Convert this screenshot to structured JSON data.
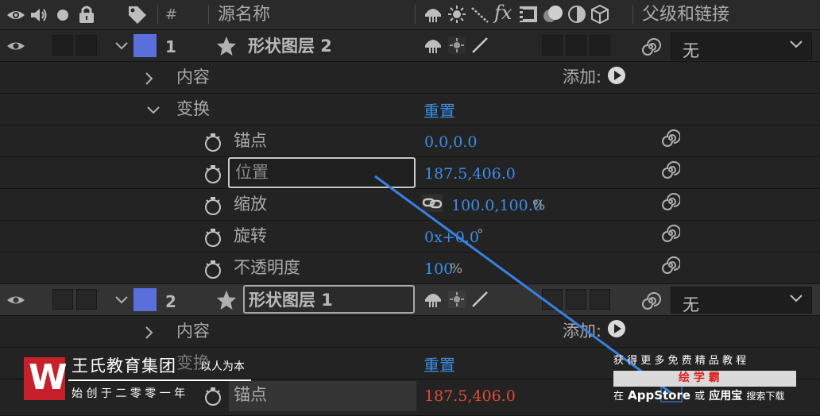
{
  "header": {
    "col_hash": "#",
    "col_source_name": "源名称",
    "col_parent": "父级和链接"
  },
  "layers": [
    {
      "number": "1",
      "name": "形状图层 2",
      "parent_value": "无",
      "color": "#5a6fdc"
    },
    {
      "number": "2",
      "name": "形状图层 1",
      "parent_value": "无",
      "color": "#5a6fdc"
    }
  ],
  "groups": {
    "contents": "内容",
    "add_label": "添加:",
    "transform": "变换",
    "reset": "重置"
  },
  "properties": {
    "anchor": {
      "label": "锚点",
      "value": "0.0,0.0"
    },
    "position": {
      "label": "位置",
      "value": "187.5,406.0"
    },
    "scale": {
      "label": "缩放",
      "value": "100.0,100.0",
      "unit": "%"
    },
    "rotation": {
      "label": "旋转",
      "value": "0x+0.0",
      "unit": "°"
    },
    "opacity": {
      "label": "不透明度",
      "value": "100",
      "unit": "%"
    }
  },
  "layer2_props": {
    "contents": "内容",
    "add_label": "添加:",
    "transform": "变换",
    "reset": "重置",
    "anchor_label": "锚点",
    "anchor_value": "187.5,406.0"
  },
  "watermark_left": {
    "title": "王氏教育集团",
    "slogan": "以人为本",
    "subtitle": "始 创 于 二 零 零 一 年",
    "logo_letter": "W"
  },
  "watermark_right": {
    "line1": "获 得 更 多 免 费 精 品 教 程",
    "brand": "绘 学 霸",
    "line3_prefix": "在",
    "line3_appstore": "AppStore",
    "line3_mid": "或",
    "line3_store": "应用宝",
    "line3_suffix": "搜索下载"
  },
  "colors": {
    "accent_blue": "#3a8ee6",
    "label_color": "#5a6fdc",
    "keyframe_red": "#e04a3a",
    "annotation_line": "#3a80e0"
  }
}
